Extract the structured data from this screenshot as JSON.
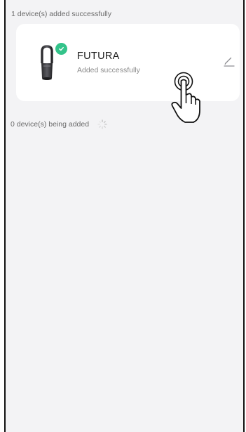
{
  "added_section": {
    "header": "1 device(s) added successfully"
  },
  "device": {
    "name": "FUTURA",
    "status": "Added successfully",
    "image_icon": "tower-fan-device-icon",
    "badge_icon": "check-badge-icon",
    "edit_icon": "pencil-edit-icon"
  },
  "adding_section": {
    "label": "0 device(s) being added",
    "spinner_icon": "loading-spinner-icon"
  },
  "overlay": {
    "cursor_icon": "hand-pointer-cursor-icon"
  },
  "colors": {
    "background": "#f3f3f5",
    "card": "#ffffff",
    "success": "#33c38a",
    "secondary_text": "#6a6a6a"
  }
}
